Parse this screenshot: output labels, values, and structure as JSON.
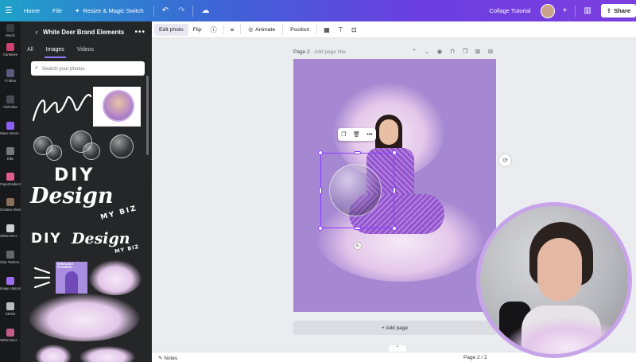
{
  "topbar": {
    "home": "Home",
    "file": "File",
    "resize": "Resize & Magic Switch",
    "project_title": "Collage Tutorial",
    "share": "Share",
    "colors": {
      "gradient_start": "#1fa1c9",
      "gradient_end": "#7c3ee0"
    }
  },
  "rail": {
    "items": [
      {
        "label": "Merch",
        "color": "#3a3a40"
      },
      {
        "label": "CanWave",
        "color": "#d0416d"
      },
      {
        "label": "Fi Mina",
        "color": "#5a5b7c"
      },
      {
        "label": "Old Erika",
        "color": "#4a4a55"
      },
      {
        "label": "Wave Gener...",
        "color": "#8b5cf6"
      },
      {
        "label": "Ellie",
        "color": "#777"
      },
      {
        "label": "PopeGradient",
        "color": "#e05a8f"
      },
      {
        "label": "Creative Elem...",
        "color": "#8a6e5a"
      },
      {
        "label": "White Deer ...",
        "color": "#cfcfd3"
      },
      {
        "label": "Club Testimo...",
        "color": "#666"
      },
      {
        "label": "Image Upscal...",
        "color": "#9b6cf0"
      },
      {
        "label": "Clients",
        "color": "#bbb"
      },
      {
        "label": "White Deer ...",
        "color": "#c05b8a"
      }
    ]
  },
  "panel": {
    "title": "White Deer Brand Elements",
    "tabs": [
      "All",
      "Images",
      "Videos"
    ],
    "active_tab": "Images",
    "search_placeholder": "Search your photos",
    "diy_1": "DIY",
    "design_1": "Design",
    "my_biz_1": "MY BIZ",
    "diy_2": "DIY",
    "design_2": "Design",
    "my_biz_2": "MY BIZ",
    "promo_text": "SERIOUSLY STUNNING"
  },
  "toolbar": {
    "edit_photo": "Edit photo",
    "flip": "Flip",
    "animate": "Animate",
    "position": "Position"
  },
  "canvas": {
    "page_label": "Page 2",
    "page_title_placeholder": "- Add page title",
    "add_page": "+ Add page",
    "notes": "Notes",
    "pager": "Page 2 / 2",
    "artboard_color": "#a688d2"
  }
}
